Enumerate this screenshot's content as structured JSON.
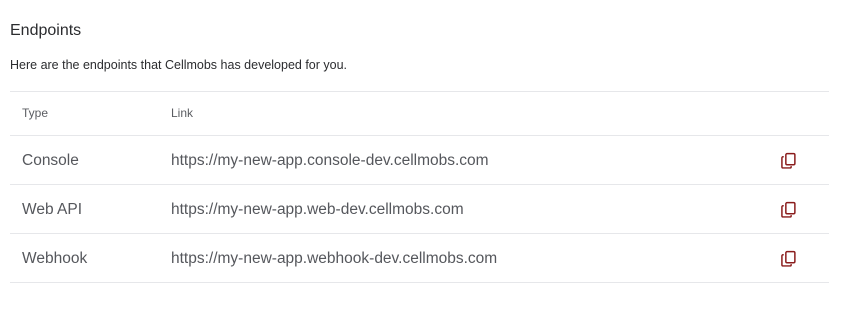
{
  "section": {
    "title": "Endpoints",
    "subtitle": "Here are the endpoints that Cellmobs has developed for you."
  },
  "table": {
    "headers": {
      "type": "Type",
      "link": "Link"
    },
    "rows": [
      {
        "type": "Console",
        "link": "https://my-new-app.console-dev.cellmobs.com",
        "action_icon": "copy-icon"
      },
      {
        "type": "Web API",
        "link": "https://my-new-app.web-dev.cellmobs.com",
        "action_icon": "copy-icon"
      },
      {
        "type": "Webhook",
        "link": "https://my-new-app.webhook-dev.cellmobs.com",
        "action_icon": "copy-icon"
      }
    ]
  },
  "colors": {
    "copy_icon": "#8a1c1c",
    "divider": "#e6e7ea",
    "text": "#55575c"
  }
}
